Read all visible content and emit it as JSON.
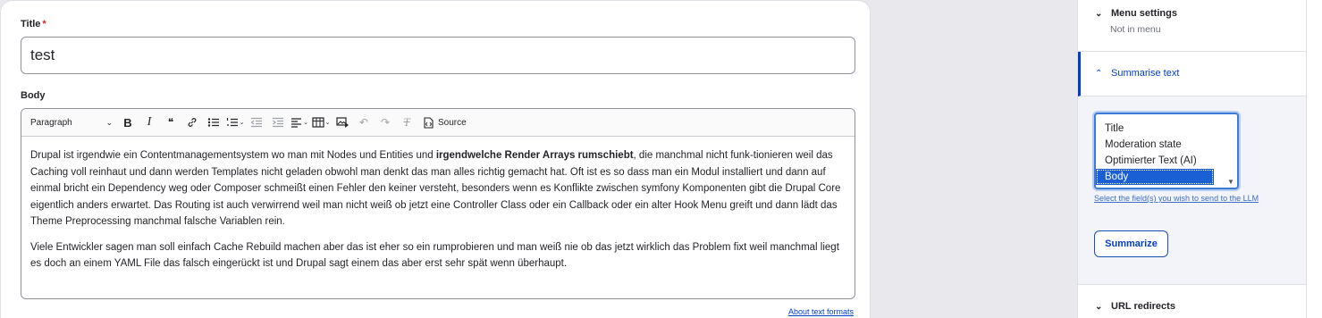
{
  "title_field": {
    "label": "Title",
    "required_mark": "*",
    "value": "test"
  },
  "body_field": {
    "label": "Body",
    "about_link": "About text formats"
  },
  "toolbar": {
    "paragraph_select": "Paragraph",
    "bold": "B",
    "italic": "I",
    "blockquote": "❝",
    "link": "🔗",
    "bulleted_list": "☰",
    "numbered_list": "☷",
    "outdent": "⇤",
    "indent": "⇥",
    "align": "≡",
    "table": "▦",
    "media": "▣",
    "undo": "↶",
    "redo": "↷",
    "remove_format": "T",
    "source_label": "Source",
    "source_icon": "⌘"
  },
  "body_content": {
    "p1_before": "Drupal ist irgendwie ein Contentmanagementsystem wo man mit Nodes und Entities und ",
    "p1_bold": "irgendwelche Render Arrays rumschiebt",
    "p1_after": ", die manchmal nicht funk-tionieren weil das Caching voll reinhaut und dann werden Templates nicht geladen obwohl man denkt das man alles richtig gemacht hat. Oft ist es so dass man ein Modul installiert und dann auf einmal bricht ein Dependency weg oder Composer schmeißt einen Fehler den keiner versteht, besonders wenn es Konflikte zwischen symfony Komponenten gibt die Drupal Core eigentlich anders erwartet. Das Routing ist auch verwirrend weil man nicht weiß ob jetzt eine Controller Class oder ein Callback oder ein alter Hook Menu greift und dann lädt das Theme Preprocessing manchmal falsche Variablen rein.",
    "p2": "Viele Entwickler sagen man soll einfach Cache Rebuild machen aber das ist eher so ein rumprobieren und man weiß nie ob das jetzt wirklich das Problem fixt weil manchmal liegt es doch an einem YAML File das falsch eingerückt ist und Drupal sagt einem das aber erst sehr spät wenn überhaupt."
  },
  "sidebar": {
    "menu_settings": {
      "title": "Menu settings",
      "status": "Not in menu",
      "icon": "chevron-down-icon"
    },
    "summarise": {
      "title": "Summarise text",
      "icon": "chevron-up-icon",
      "options": [
        "Title",
        "Moderation state",
        "Optimierter Text (AI)",
        "Body"
      ],
      "selected": "Body",
      "help": "Select the field(s) you wish to send to the LLM",
      "button": "Summarize"
    },
    "url_redirects": {
      "title": "URL redirects",
      "icon": "chevron-down-icon"
    }
  },
  "colors": {
    "accent": "#003ecc",
    "required": "#d72222",
    "selected_option": "#1a5fd4"
  }
}
